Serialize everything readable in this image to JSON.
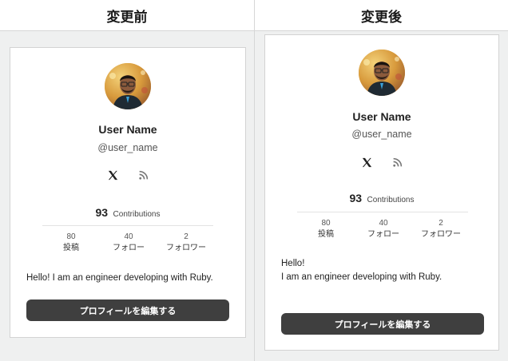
{
  "columns": {
    "before": {
      "title": "変更前"
    },
    "after": {
      "title": "変更後"
    }
  },
  "profile": {
    "name": "User Name",
    "handle": "@user_name",
    "social_icons": [
      "x-icon",
      "rss-icon"
    ],
    "contributions": {
      "value": "93",
      "label": "Contributions"
    },
    "stats": [
      {
        "value": "80",
        "label": "投稿"
      },
      {
        "value": "40",
        "label": "フォロー"
      },
      {
        "value": "2",
        "label": "フォロワー"
      }
    ],
    "edit_button_label": "プロフィールを編集する"
  },
  "before_bio": "Hello! I am an engineer developing with Ruby.",
  "after_bio": {
    "line1": "Hello!",
    "line2": "I am an engineer developing with Ruby."
  }
}
